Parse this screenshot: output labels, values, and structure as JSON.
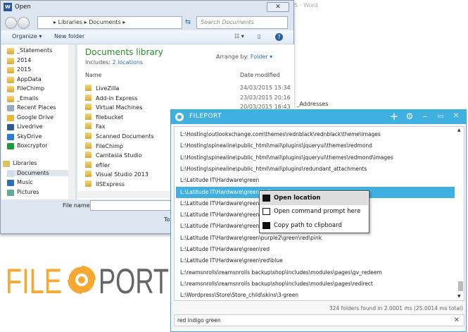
{
  "background": {
    "word_title": "5 - Word",
    "addresses": "» _Addresses"
  },
  "open_dialog": {
    "title": "Open",
    "address": [
      "Libraries",
      "Documents"
    ],
    "search_placeholder": "Search Documents",
    "toolbar": {
      "organize": "Organize ▾",
      "new_folder": "New folder"
    },
    "nav": [
      {
        "label": "_Statements",
        "icon": "folder"
      },
      {
        "label": "2014",
        "icon": "folder"
      },
      {
        "label": "2015",
        "icon": "folder"
      },
      {
        "label": "AppData",
        "icon": "folder"
      },
      {
        "label": "FileChimp",
        "icon": "folder"
      },
      {
        "label": "_Emails",
        "icon": "folder"
      },
      {
        "label": "Recent Places",
        "icon": "recent-places"
      },
      {
        "label": "Google Drive",
        "icon": "google-drive"
      },
      {
        "label": "Livedrive",
        "icon": "livedrive"
      },
      {
        "label": "SkyDrive",
        "icon": "skydrive"
      },
      {
        "label": "Boxcryptor",
        "icon": "boxcryptor"
      },
      {
        "label": "Libraries",
        "icon": "libraries"
      },
      {
        "label": "Documents",
        "icon": "documents"
      },
      {
        "label": "Music",
        "icon": "music"
      },
      {
        "label": "Pictures",
        "icon": "pictures"
      }
    ],
    "library_title": "Documents library",
    "includes_label": "Includes:",
    "includes_link": "2 locations",
    "arrange_label": "Arrange by:",
    "arrange_value": "Folder ▾",
    "columns": {
      "name": "Name",
      "date": "Date modified"
    },
    "files": [
      {
        "name": "LiveZilla",
        "date": "24/03/2015 15:34"
      },
      {
        "name": "Add-in Express",
        "date": "23/03/2015 20:16"
      },
      {
        "name": "Virtual Machines",
        "date": "20/03/2015 16:43"
      },
      {
        "name": "filebucket",
        "date": ""
      },
      {
        "name": "Fax",
        "date": ""
      },
      {
        "name": "Scanned Documents",
        "date": ""
      },
      {
        "name": "FileChimp",
        "date": ""
      },
      {
        "name": "Camtasia Studio",
        "date": ""
      },
      {
        "name": "efiler",
        "date": ""
      },
      {
        "name": "Visual Studio 2013",
        "date": ""
      },
      {
        "name": "IISExpress",
        "date": ""
      }
    ],
    "file_name_label": "File name:",
    "file_name_value": "",
    "tools_label": "To"
  },
  "logo": {
    "text_left": "FILE",
    "text_right": "PORT",
    "colors": {
      "left": "#f6a833",
      "right": "#666666"
    }
  },
  "fileport": {
    "title": "FILEPORT",
    "accent": "#3fb0e0",
    "results": [
      "L:\\Hosting\\outlookxchange.com\\themes\\rednblack\\rednblack\\theme\\images",
      "L:\\Hosting\\spinealine\\public_html\\mail\\plugins\\jqueryui\\themes\\redmond",
      "L:\\Hosting\\spinealine\\public_html\\mail\\plugins\\jqueryui\\themes\\redmond\\images",
      "L:\\Hosting\\spinealine\\public_html\\mail\\plugins\\redundant_attachments",
      "L:\\Latitude IT\\Hardware\\green",
      "L:\\Latitude IT\\Hardware\\green\\indigo",
      "L:\\Latitude IT\\Hardware\\green\\pur",
      "L:\\Latitude IT\\Hardware\\green\\pur",
      "L:\\Latitude IT\\Hardware\\green\\pur",
      "L:\\Latitude IT\\Hardware\\green\\purple2\\green\\red\\pink",
      "L:\\Latitude IT\\Hardware\\green\\red",
      "L:\\Latitude IT\\Hardware\\green\\red\\blue",
      "L:\\reamsnrolls\\reamsnrolls backup\\shop\\includes\\modules\\pages\\gv_redeem",
      "L:\\reamsnrolls\\reamsnrolls backup\\shop\\includes\\modules\\pages\\redirect",
      "L:\\Wordpress\\Store\\Store_child\\skins\\3-green"
    ],
    "selected_index": 5,
    "status": "324 folders found in 2.0001 ms (25.0014 ms total)",
    "search_value": "red indigo green",
    "context_menu": [
      {
        "label": "Open location",
        "icon": "folder-open-icon"
      },
      {
        "label": "Open command prompt here",
        "icon": "command-prompt-icon"
      },
      {
        "label": "Copy path to clipboard",
        "icon": "clipboard-icon"
      }
    ]
  }
}
